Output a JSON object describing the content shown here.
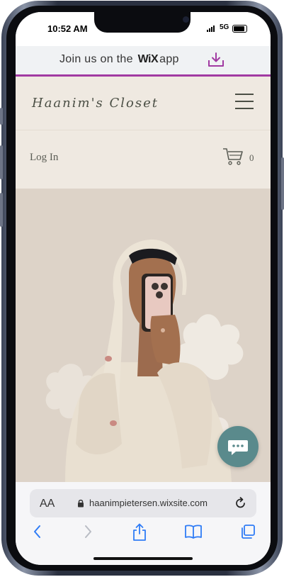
{
  "status_bar": {
    "time": "10:52 AM",
    "network": "5G"
  },
  "banner": {
    "text_before": "Join us on the",
    "brand": "WiX",
    "text_after": "app"
  },
  "header": {
    "site_title": "Haanim's Closet"
  },
  "account": {
    "login_label": "Log In",
    "cart_count": "0"
  },
  "browser": {
    "text_size_label": "AA",
    "url": "haanimpietersen.wixsite.com"
  },
  "colors": {
    "accent": "#a13aa2",
    "chat": "#5a8a8c",
    "link_blue": "#2f7cf6"
  }
}
